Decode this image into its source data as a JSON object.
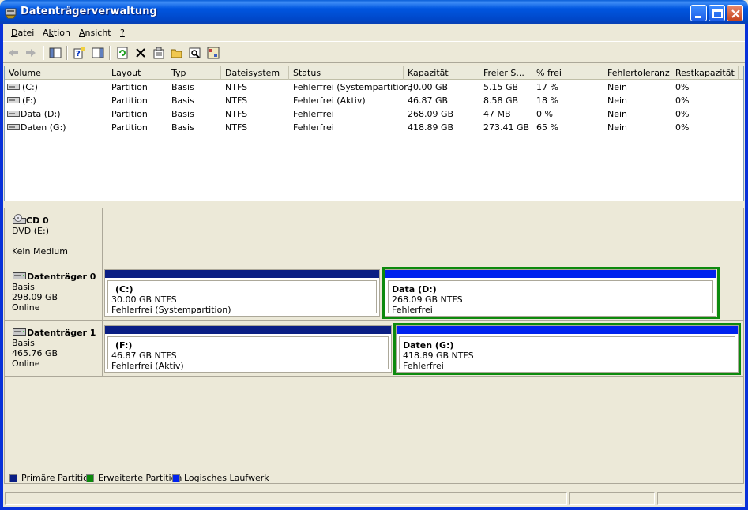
{
  "window": {
    "title": "Datenträgerverwaltung",
    "title_icon": "disk-management-icon"
  },
  "menu": {
    "items": [
      {
        "label": "Datei",
        "underline": "D",
        "rest": "atei"
      },
      {
        "label": "Aktion",
        "underline": "k",
        "pre": "A",
        "rest": "tion"
      },
      {
        "label": "Ansicht",
        "underline": "A",
        "rest": "nsicht"
      },
      {
        "label": "?",
        "underline": "?",
        "rest": ""
      }
    ]
  },
  "toolbar": {
    "buttons": [
      "back-icon",
      "forward-icon",
      "show-hide-console-tree-icon",
      "help-icon",
      "show-hide-action-pane-icon",
      "refresh-icon",
      "delete-icon",
      "properties-icon",
      "open-icon",
      "search-icon",
      "export-icon"
    ]
  },
  "volumes": {
    "columns": [
      "Volume",
      "Layout",
      "Typ",
      "Dateisystem",
      "Status",
      "Kapazität",
      "Freier S...",
      "% frei",
      "Fehlertoleranz",
      "Restkapazität"
    ],
    "rows": [
      [
        "(C:)",
        "Partition",
        "Basis",
        "NTFS",
        "Fehlerfrei (Systempartition)",
        "30.00 GB",
        "5.15 GB",
        "17 %",
        "Nein",
        "0%"
      ],
      [
        "(F:)",
        "Partition",
        "Basis",
        "NTFS",
        "Fehlerfrei (Aktiv)",
        "46.87 GB",
        "8.58 GB",
        "18 %",
        "Nein",
        "0%"
      ],
      [
        "Data (D:)",
        "Partition",
        "Basis",
        "NTFS",
        "Fehlerfrei",
        "268.09 GB",
        "47 MB",
        "0 %",
        "Nein",
        "0%"
      ],
      [
        "Daten (G:)",
        "Partition",
        "Basis",
        "NTFS",
        "Fehlerfrei",
        "418.89 GB",
        "273.41 GB",
        "65 %",
        "Nein",
        "0%"
      ]
    ]
  },
  "disks": [
    {
      "name": "CD 0",
      "line1": "DVD (E:)",
      "line2": "",
      "line3": "Kein Medium",
      "partitions": []
    },
    {
      "name": "Datenträger 0",
      "line1": "Basis",
      "line2": "298.09 GB",
      "line3": "Online",
      "partitions": [
        {
          "name": "(C:)",
          "size": "30.00 GB NTFS",
          "status": "Fehlerfrei (Systempartition)",
          "kind": "primary"
        },
        {
          "name": "Data  (D:)",
          "size": "268.09 GB NTFS",
          "status": "Fehlerfrei",
          "kind": "logical"
        }
      ]
    },
    {
      "name": "Datenträger 1",
      "line1": "Basis",
      "line2": "465.76 GB",
      "line3": "Online",
      "partitions": [
        {
          "name": "(F:)",
          "size": "46.87 GB NTFS",
          "status": "Fehlerfrei (Aktiv)",
          "kind": "primary"
        },
        {
          "name": "Daten  (G:)",
          "size": "418.89 GB NTFS",
          "status": "Fehlerfrei",
          "kind": "logical"
        }
      ]
    }
  ],
  "legend": [
    {
      "label": "Primäre Partition",
      "color": "#0a1e84"
    },
    {
      "label": "Erweiterte Partition",
      "color": "#0d8a0d"
    },
    {
      "label": "Logisches Laufwerk",
      "color": "#0022ee"
    }
  ],
  "colors": {
    "primary": "#0a1e84",
    "extended": "#0d8a0d",
    "logical": "#0022ee",
    "titlebar": "#0054e3"
  }
}
